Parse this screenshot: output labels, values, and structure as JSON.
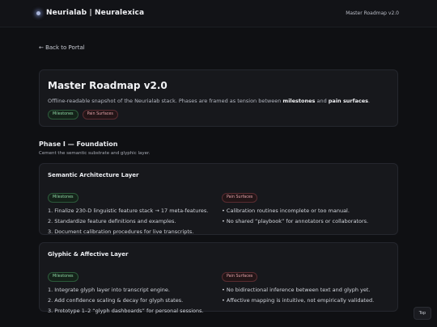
{
  "topbar": {
    "brand": "Neurialab | Neuralexica",
    "version": "Master Roadmap v2.0"
  },
  "nav": {
    "back_label": "← Back to Portal"
  },
  "hero": {
    "title": "Master Roadmap v2.0",
    "subtitle_start": "Offline-readable snapshot of the Neurialab stack. Phases are framed as tension between ",
    "subtitle_bold1": "milestones",
    "subtitle_mid": " and ",
    "subtitle_bold2": "pain surfaces",
    "subtitle_end": ".",
    "chips": {
      "milestones": "Milestones",
      "pain": "Pain Surfaces"
    }
  },
  "phase": {
    "title": "Phase I — Foundation",
    "subtitle": "Cement the semantic substrate and glyphic layer."
  },
  "layers": [
    {
      "title": "Semantic Architecture Layer",
      "milestones_label": "Milestones",
      "pain_label": "Pain Surfaces",
      "milestones": [
        "1. Finalize 230-D linguistic feature stack → 17 meta-features.",
        "2. Standardize feature definitions and examples.",
        "3. Document calibration procedures for live transcripts."
      ],
      "pains": [
        "• Calibration routines incomplete or too manual.",
        "• No shared “playbook” for annotators or collaborators."
      ]
    },
    {
      "title": "Glyphic & Affective Layer",
      "milestones_label": "Milestones",
      "pain_label": "Pain Surfaces",
      "milestones": [
        "1. Integrate glyph layer into transcript engine.",
        "2. Add confidence scaling & decay for glyph states.",
        "3. Prototype 1–2 “glyph dashboards” for personal sessions."
      ],
      "pains": [
        "• No bidirectional inference between text and glyph yet.",
        "• Affective mapping is intuitive, not empirically validated."
      ]
    }
  ],
  "footer": {
    "top_label": "Top"
  }
}
